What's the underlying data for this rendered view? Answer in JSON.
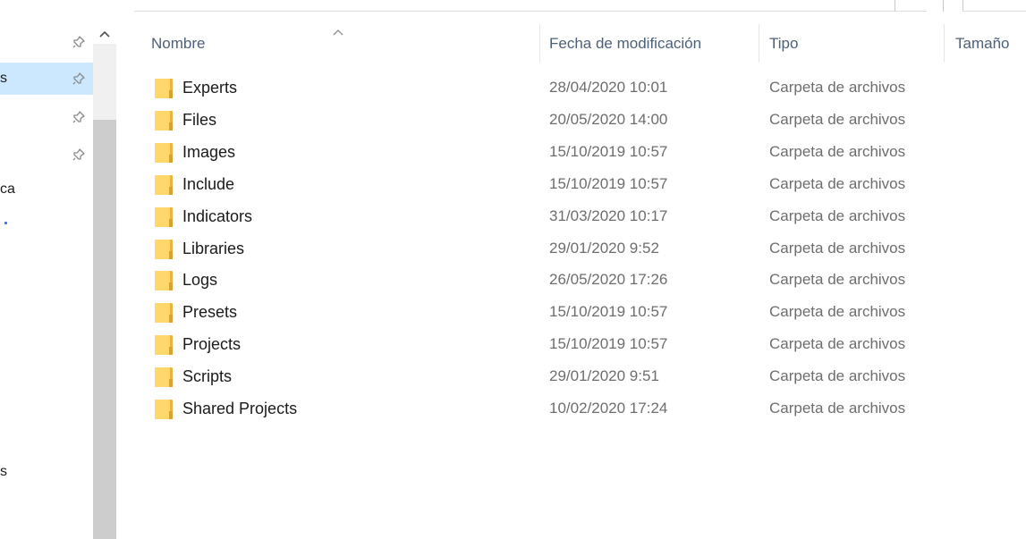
{
  "nav": {
    "items": [
      {
        "label": "",
        "pinned": true,
        "selected": false
      },
      {
        "label": "s",
        "pinned": true,
        "selected": true
      },
      {
        "label": "",
        "pinned": true,
        "selected": false
      },
      {
        "label": "",
        "pinned": true,
        "selected": false
      },
      {
        "label": "ca",
        "pinned": false,
        "selected": false
      },
      {
        "label": "s",
        "pinned": false,
        "selected": false
      }
    ]
  },
  "header": {
    "name": "Nombre",
    "date": "Fecha de modificación",
    "type": "Tipo",
    "size": "Tamaño",
    "sorted_by": "Nombre",
    "sort_direction": "ascending"
  },
  "files": [
    {
      "name": "Experts",
      "date": "28/04/2020 10:01",
      "type": "Carpeta de archivos"
    },
    {
      "name": "Files",
      "date": "20/05/2020 14:00",
      "type": "Carpeta de archivos"
    },
    {
      "name": "Images",
      "date": "15/10/2019 10:57",
      "type": "Carpeta de archivos"
    },
    {
      "name": "Include",
      "date": "15/10/2019 10:57",
      "type": "Carpeta de archivos"
    },
    {
      "name": "Indicators",
      "date": "31/03/2020 10:17",
      "type": "Carpeta de archivos"
    },
    {
      "name": "Libraries",
      "date": "29/01/2020 9:52",
      "type": "Carpeta de archivos"
    },
    {
      "name": "Logs",
      "date": "26/05/2020 17:26",
      "type": "Carpeta de archivos"
    },
    {
      "name": "Presets",
      "date": "15/10/2019 10:57",
      "type": "Carpeta de archivos"
    },
    {
      "name": "Projects",
      "date": "15/10/2019 10:57",
      "type": "Carpeta de archivos"
    },
    {
      "name": "Scripts",
      "date": "29/01/2020 9:51",
      "type": "Carpeta de archivos"
    },
    {
      "name": "Shared Projects",
      "date": "10/02/2020 17:24",
      "type": "Carpeta de archivos"
    }
  ],
  "colors": {
    "selection": "#cce8ff",
    "header_text": "#4c607a",
    "secondary_text": "#6d6d6d",
    "folder_fill": "#ffd76b",
    "folder_back": "#e8b53f",
    "scroll_thumb": "#cdcdcd"
  },
  "icons": {
    "folder": "folder-icon",
    "pin": "pin-icon",
    "scroll_up": "chevron-up-icon",
    "sort": "sort-ascending-icon"
  }
}
